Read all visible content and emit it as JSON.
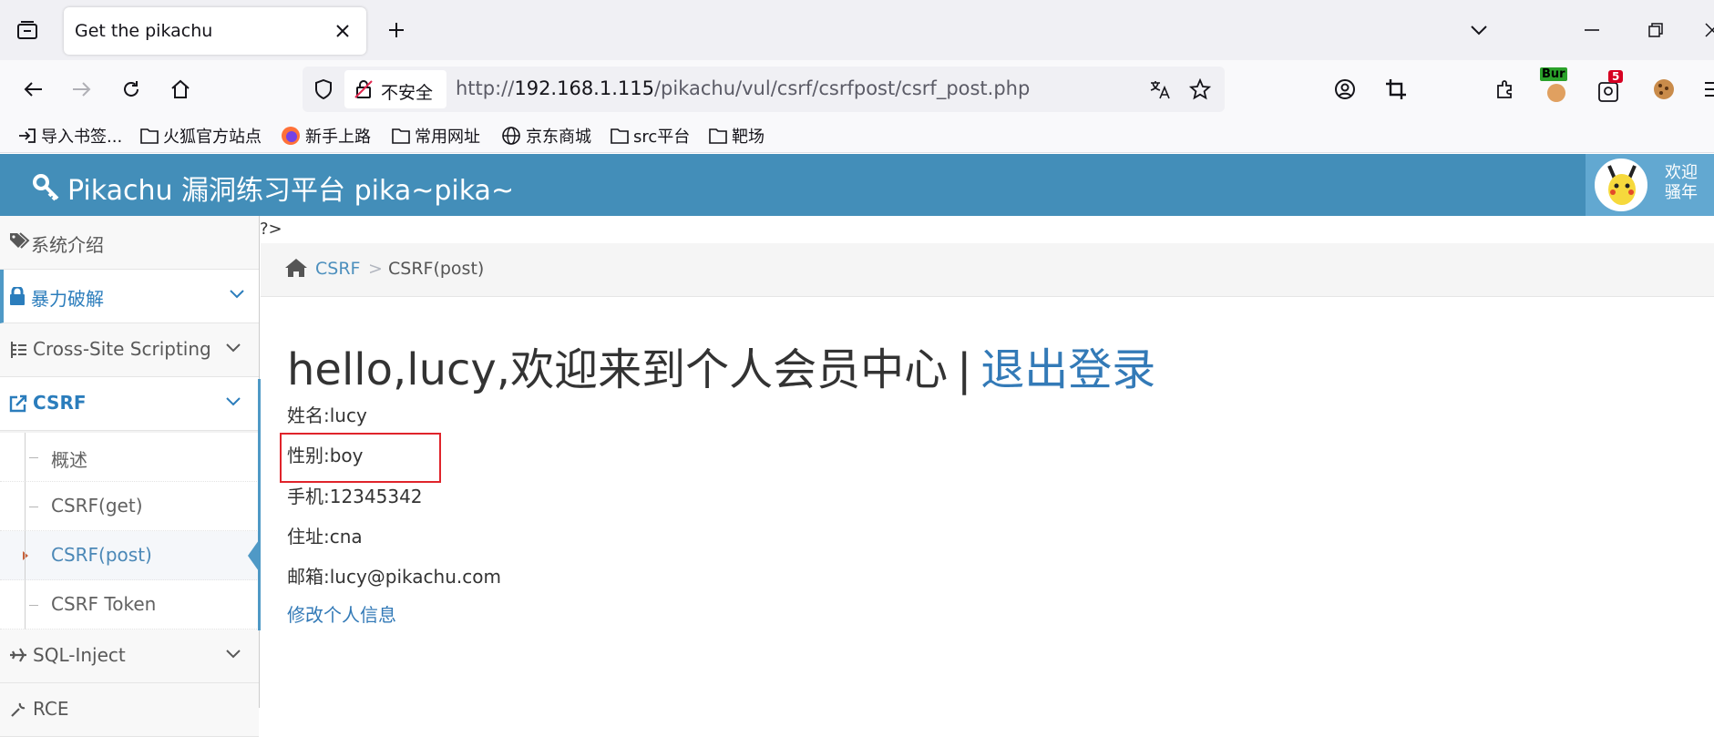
{
  "browser": {
    "tab_title": "Get the pikachu",
    "insecure_label": "不安全",
    "url_prefix": "http://",
    "url_host": "192.168.1.115",
    "url_path": "/pikachu/vul/csrf/csrfpost/csrf_post.php",
    "bookmarks": [
      "导入书签...",
      "火狐官方站点",
      "新手上路",
      "常用网址",
      "京东商城",
      "src平台",
      "靶场"
    ],
    "extensions": {
      "burp_label": "Bur",
      "badge_count": "5"
    }
  },
  "site": {
    "title": "Pikachu 漏洞练习平台 pika~pika~",
    "welcome_line1": "欢迎",
    "welcome_line2": "骚年",
    "stray_text": "?>"
  },
  "sidebar": {
    "items": [
      {
        "label": "系统介绍",
        "icon": "tags-icon"
      },
      {
        "label": "暴力破解",
        "icon": "lock-icon"
      },
      {
        "label": "Cross-Site Scripting",
        "icon": "list-icon"
      },
      {
        "label": "CSRF",
        "icon": "external-link-icon"
      },
      {
        "label": "SQL-Inject",
        "icon": "plane-icon"
      },
      {
        "label": "RCE",
        "icon": "wrench-icon"
      }
    ],
    "csrf_sub": [
      "概述",
      "CSRF(get)",
      "CSRF(post)",
      "CSRF Token"
    ]
  },
  "breadcrumb": {
    "parent": "CSRF",
    "separator": ">",
    "current": "CSRF(post)"
  },
  "main": {
    "heading_greeting": "hello,lucy,欢迎来到个人会员中心",
    "heading_separator": "|",
    "logout_label": "退出登录",
    "fields": {
      "name": "姓名:lucy",
      "gender": "性别:boy",
      "phone": "手机:12345342",
      "address": "住址:cna",
      "email": "邮箱:lucy@pikachu.com"
    },
    "edit_link": "修改个人信息"
  },
  "colors": {
    "header_bg": "#438eb9",
    "link": "#337ab7",
    "highlight": "#e0242b"
  }
}
